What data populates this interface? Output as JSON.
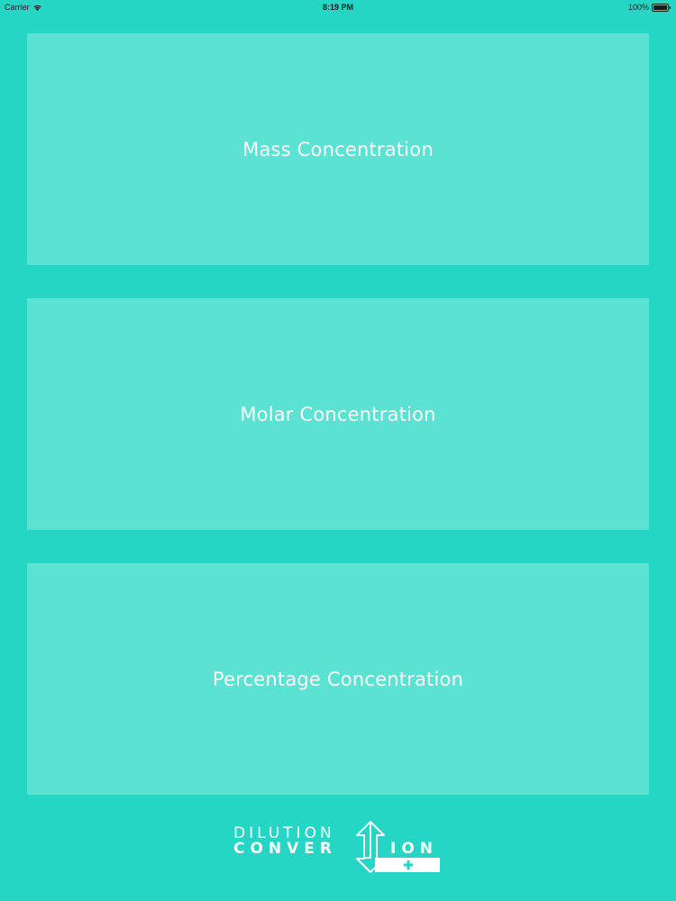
{
  "status_bar": {
    "carrier": "Carrier",
    "time": "8:19 PM",
    "battery": "100%"
  },
  "cards": [
    {
      "label": "Mass Concentration"
    },
    {
      "label": "Molar Concentration"
    },
    {
      "label": "Percentage Concentration"
    }
  ],
  "logo": {
    "line1": "DILUTION",
    "line2_left": "CONVER",
    "line2_right": "ION"
  },
  "colors": {
    "background": "#24d6c3",
    "card": "#5ce2d3",
    "text": "#ffffff"
  }
}
